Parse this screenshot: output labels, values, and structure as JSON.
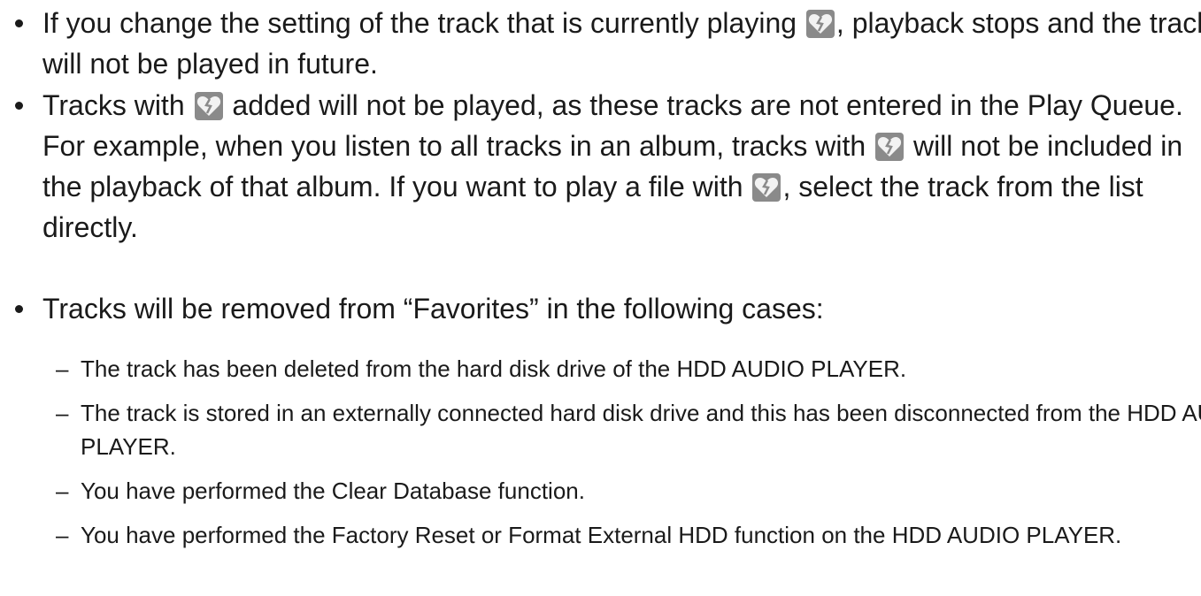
{
  "bullets": [
    {
      "segments": [
        "If you change the setting of the track that is currently playing ",
        ", playback stops and the track will not be played in future."
      ]
    },
    {
      "segments": [
        "Tracks with ",
        " added will not be played, as these tracks are not entered in the Play Queue. For example, when you listen to all tracks in an album, tracks with ",
        " will not be included in the playback of that album. If you want to play a file with ",
        ", select the track from the list directly."
      ]
    },
    {
      "segments": [
        "Tracks will be removed from “Favorites” in the following cases:"
      ]
    }
  ],
  "sub_items": [
    "The track has been deleted from the hard disk drive of the HDD AUDIO PLAYER.",
    "The track is stored in an externally connected hard disk drive and this has been disconnected from the HDD AUDIO PLAYER.",
    "You have performed the Clear Database function.",
    "You have performed the Factory Reset or Format External HDD function on the HDD AUDIO PLAYER."
  ],
  "dash_glyph": "–",
  "icons": {
    "heart": "broken-heart-icon",
    "heart_bg": "#8a8a8a",
    "heart_color": "#f2f2f2"
  }
}
